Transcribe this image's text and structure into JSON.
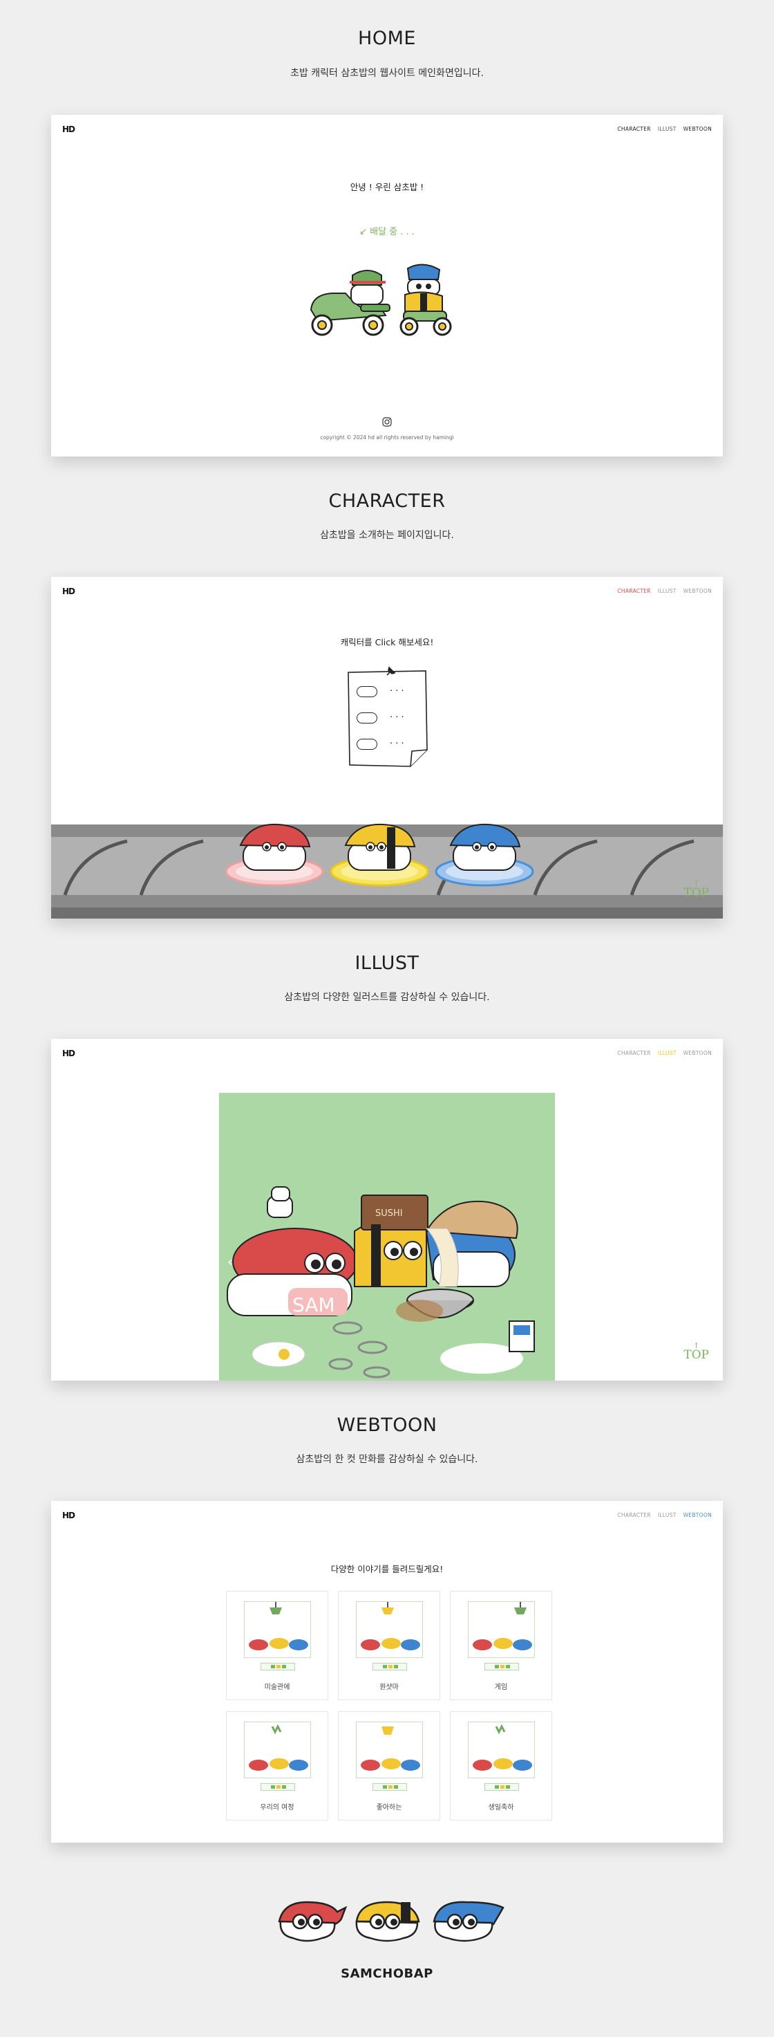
{
  "sections": {
    "home": {
      "title": "HOME",
      "desc": "초밥 캐릭터 삼초밥의 웹사이트 메인화면입니다."
    },
    "character": {
      "title": "CHARACTER",
      "desc": "삼초밥을 소개하는 페이지입니다."
    },
    "illust": {
      "title": "ILLUST",
      "desc": "삼초밥의 다양한 일러스트를 감상하실 수 있습니다."
    },
    "webtoon": {
      "title": "WEBTOON",
      "desc": "삼초밥의 한 컷 만화를 감상하실 수 있습니다."
    }
  },
  "site": {
    "logo": "HD",
    "nav": [
      "CHARACTER",
      "ILLUST",
      "WEBTOON"
    ],
    "nav_colors": {
      "character": "#e84a4a",
      "illust": "#f0c419",
      "webtoon": "#4a8fd6"
    }
  },
  "home_page": {
    "greeting": "안녕 ! 우린 삼초밥 !",
    "status": "↙ 배달 중 . . .",
    "copyright": "copyright © 2024 hd all rights reserved by hamingi"
  },
  "character_page": {
    "prompt": "캐릭터를 Click 해보세요!",
    "menu_dots": "· · ·",
    "top": "TOP",
    "top_arrow": "↑"
  },
  "illust_page": {
    "arrow": "‹",
    "book_label": "SUSHI",
    "name_tag": "SAM",
    "top": "TOP",
    "top_arrow": "↑"
  },
  "webtoon_page": {
    "prompt": "다양한 이야기를 들려드릴게요!",
    "episodes": [
      "미술관에",
      "원샷마",
      "게임",
      "우리의 여정",
      "좋아하는",
      "생일축하"
    ]
  },
  "footer": {
    "brand": "SAMCHOBAP"
  },
  "colors": {
    "red": "#d94b4b",
    "yellow": "#f2c630",
    "blue": "#3f84cf",
    "green": "#7ab55c",
    "bg": "#efefef"
  },
  "icons": [
    "instagram-icon",
    "pin-icon",
    "top-arrow-icon",
    "chevron-left-icon"
  ]
}
